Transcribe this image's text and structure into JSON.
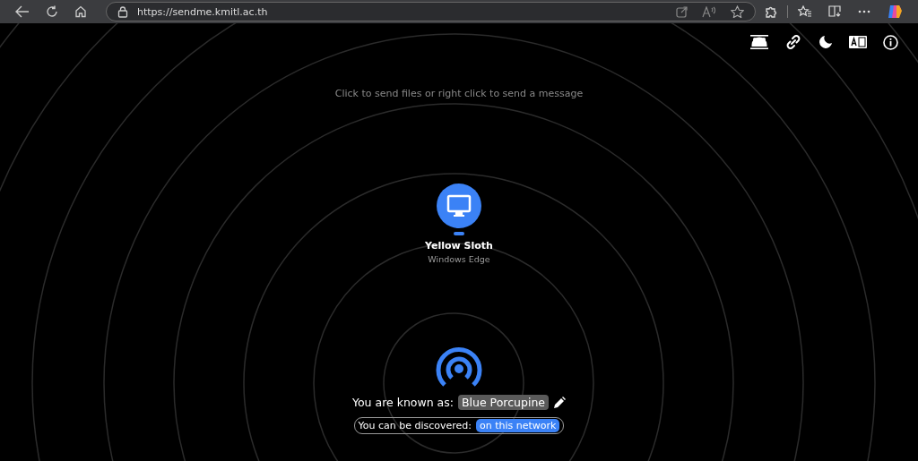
{
  "browser": {
    "url": "https://sendme.kmitl.ac.th"
  },
  "hint": "Click to send files or right click to send a message",
  "peers": [
    {
      "name": "Yellow Sloth",
      "device": "Windows Edge"
    }
  ],
  "self": {
    "label": "You are known as:",
    "name": "Blue Porcupine"
  },
  "discovery": {
    "label": "You can be discovered:",
    "value": "on this network"
  }
}
